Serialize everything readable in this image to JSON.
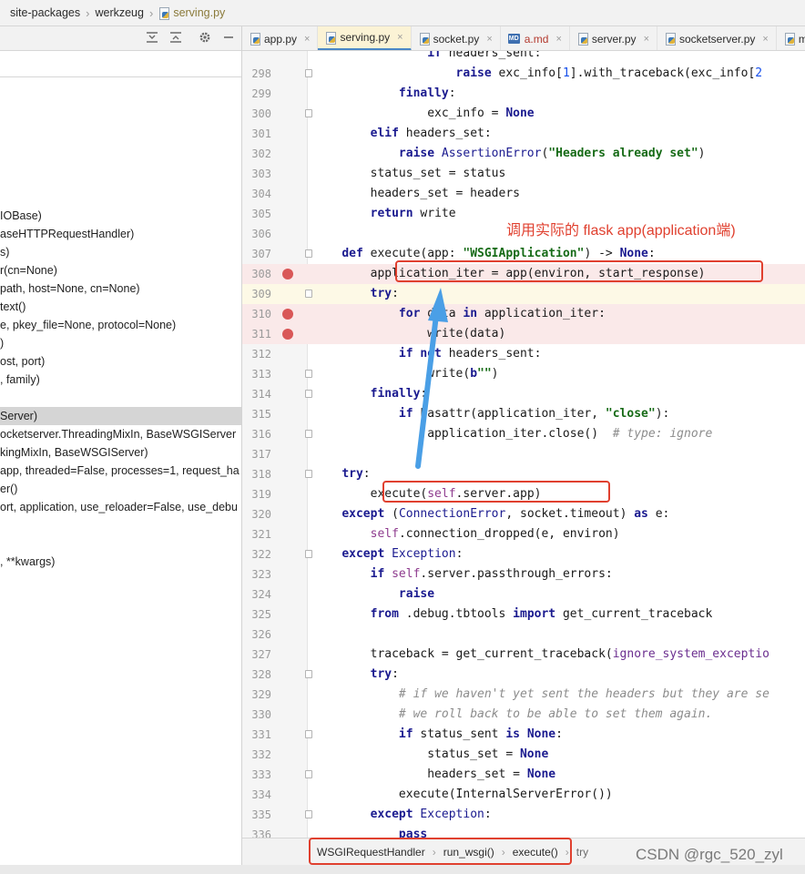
{
  "breadcrumb": {
    "items": [
      "site-packages",
      "werkzeug",
      "serving.py"
    ]
  },
  "left_toolbar": {
    "icons": [
      "expand-all-icon",
      "collapse-all-icon",
      "gear-icon",
      "minimize-icon"
    ]
  },
  "structure": {
    "items": [
      "IOBase)",
      "aseHTTPRequestHandler)",
      "s)",
      "r(cn=None)",
      "path, host=None, cn=None)",
      "text()",
      "e, pkey_file=None, protocol=None)",
      ")",
      "ost, port)",
      ", family)",
      "",
      "Server)",
      "ocketserver.ThreadingMixIn, BaseWSGIServer",
      "kingMixIn, BaseWSGIServer)",
      " app, threaded=False, processes=1, request_ha",
      "er()",
      "ort, application, use_reloader=False, use_debu",
      "",
      "",
      ", **kwargs)"
    ],
    "selected_index": 11
  },
  "tabs": [
    {
      "label": "app.py",
      "type": "py"
    },
    {
      "label": "serving.py",
      "type": "py",
      "active": true
    },
    {
      "label": "socket.py",
      "type": "py"
    },
    {
      "label": "a.md",
      "type": "md"
    },
    {
      "label": "server.py",
      "type": "py"
    },
    {
      "label": "socketserver.py",
      "type": "py"
    },
    {
      "label": "m",
      "type": "py"
    }
  ],
  "tab_close_glyph": "×",
  "code": {
    "lines": [
      {
        "n": "",
        "html": "                <span class=\"kw\">if</span> headers_sent:"
      },
      {
        "n": "298",
        "html": "                    <span class=\"kw\">raise</span> exc_info[<span class=\"num\">1</span>].with_traceback(exc_info[<span class=\"num\">2</span>"
      },
      {
        "n": "299",
        "html": "            <span class=\"kw\">finally</span>:"
      },
      {
        "n": "300",
        "html": "                exc_info = <span class=\"kw\">None</span>"
      },
      {
        "n": "301",
        "html": "        <span class=\"kw\">elif</span> headers_set:"
      },
      {
        "n": "302",
        "html": "            <span class=\"kw\">raise</span> <span class=\"cls\">AssertionError</span>(<span class=\"str\">\"Headers already set\"</span>)"
      },
      {
        "n": "303",
        "html": "        status_set = status"
      },
      {
        "n": "304",
        "html": "        headers_set = headers"
      },
      {
        "n": "305",
        "html": "        <span class=\"kw\">return</span> write"
      },
      {
        "n": "306",
        "html": ""
      },
      {
        "n": "307",
        "html": "    <span class=\"kw\">def</span> execute(app: <span class=\"str\">\"WSGIApplication\"</span>) -> <span class=\"kw\">None</span>:"
      },
      {
        "n": "308",
        "html": "        application_iter = app(environ, start_response)",
        "bp": true
      },
      {
        "n": "309",
        "html": "        <span class=\"kw\">try</span>:",
        "cur": true
      },
      {
        "n": "310",
        "html": "            <span class=\"kw\">for</span> data <span class=\"kw\">in</span> application_iter:",
        "bp": true
      },
      {
        "n": "311",
        "html": "                write(data)",
        "bp": true
      },
      {
        "n": "312",
        "html": "            <span class=\"kw\">if</span> <span class=\"kw\">not</span> headers_sent:"
      },
      {
        "n": "313",
        "html": "                write(<span class=\"kw\">b</span><span class=\"str\">\"\"</span>)"
      },
      {
        "n": "314",
        "html": "        <span class=\"kw\">finally</span>:"
      },
      {
        "n": "315",
        "html": "            <span class=\"kw\">if</span> hasattr(application_iter, <span class=\"str\">\"close\"</span>):"
      },
      {
        "n": "316",
        "html": "                application_iter.close()  <span class=\"cmt\"># type: ignore</span>"
      },
      {
        "n": "317",
        "html": ""
      },
      {
        "n": "318",
        "html": "    <span class=\"kw\">try</span>:"
      },
      {
        "n": "319",
        "html": "        execute(<span class=\"self\">self</span>.server.app)"
      },
      {
        "n": "320",
        "html": "    <span class=\"kw\">except</span> (<span class=\"cls\">ConnectionError</span>, socket.timeout) <span class=\"kw\">as</span> e:"
      },
      {
        "n": "321",
        "html": "        <span class=\"self\">self</span>.connection_dropped(e, environ)"
      },
      {
        "n": "322",
        "html": "    <span class=\"kw\">except</span> <span class=\"cls\">Exception</span>:"
      },
      {
        "n": "323",
        "html": "        <span class=\"kw\">if</span> <span class=\"self\">self</span>.server.passthrough_errors:"
      },
      {
        "n": "324",
        "html": "            <span class=\"kw\">raise</span>"
      },
      {
        "n": "325",
        "html": "        <span class=\"kw\">from</span> .debug.tbtools <span class=\"kw\">import</span> get_current_traceback"
      },
      {
        "n": "326",
        "html": ""
      },
      {
        "n": "327",
        "html": "        traceback = get_current_traceback(<span class=\"param\">ignore_system_exceptio</span>"
      },
      {
        "n": "328",
        "html": "        <span class=\"kw\">try</span>:"
      },
      {
        "n": "329",
        "html": "            <span class=\"cmt\"># if we haven't yet sent the headers but they are se</span>"
      },
      {
        "n": "330",
        "html": "            <span class=\"cmt\"># we roll back to be able to set them again.</span>"
      },
      {
        "n": "331",
        "html": "            <span class=\"kw\">if</span> status_sent <span class=\"kw\">is</span> <span class=\"kw\">None</span>:"
      },
      {
        "n": "332",
        "html": "                status_set = <span class=\"kw\">None</span>"
      },
      {
        "n": "333",
        "html": "                headers_set = <span class=\"kw\">None</span>"
      },
      {
        "n": "334",
        "html": "            execute(InternalServerError())"
      },
      {
        "n": "335",
        "html": "        <span class=\"kw\">except</span> <span class=\"cls\">Exception</span>:"
      },
      {
        "n": "336",
        "html": "            <span class=\"kw\">pass</span>"
      }
    ]
  },
  "annotation": {
    "text": "调用实际的 flask app(application端)"
  },
  "statusbar": {
    "crumbs": [
      "WSGIRequestHandler",
      "run_wsgi()",
      "execute()",
      "try"
    ]
  },
  "watermark": "CSDN @rgc_520_zyl",
  "colors": {
    "annotation_red": "#e0402f",
    "arrow_blue": "#4a9fe6",
    "breakpoint_red": "#d95757"
  }
}
